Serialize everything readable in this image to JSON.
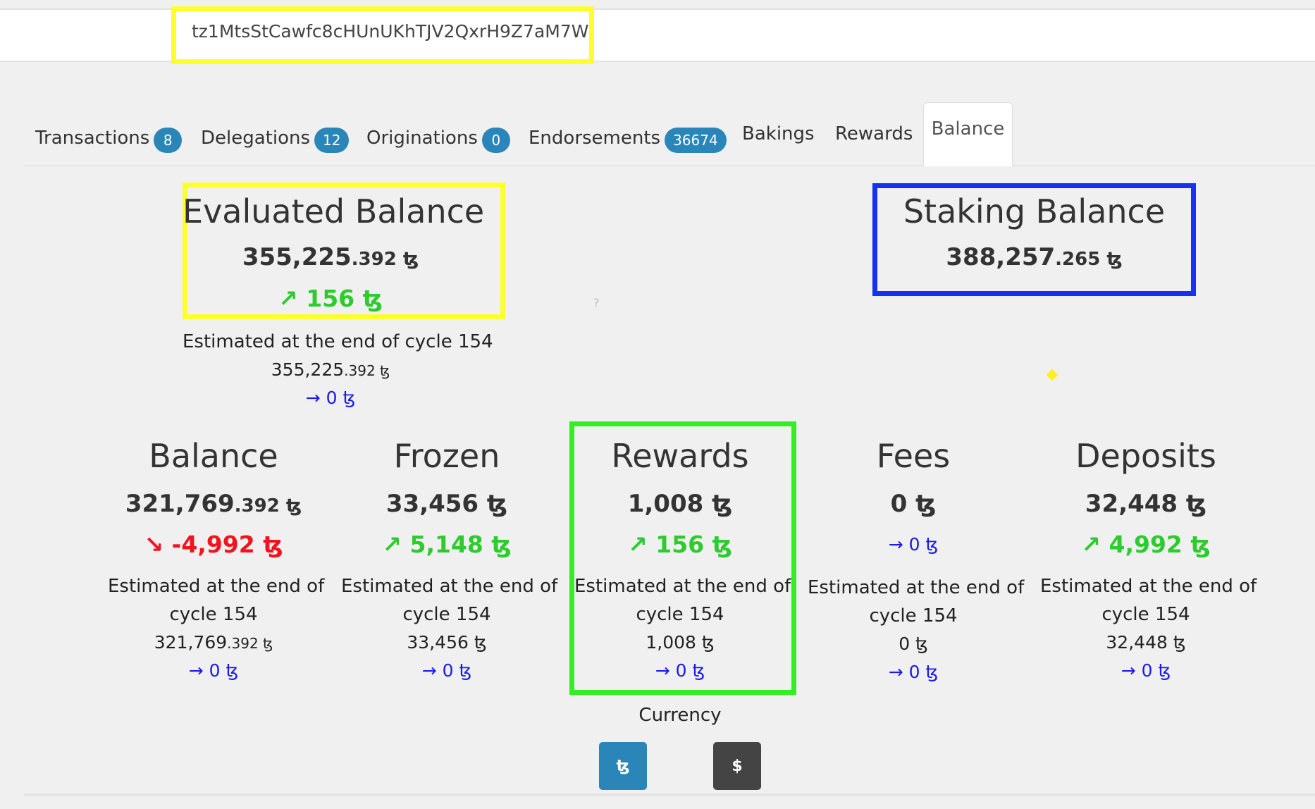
{
  "address": "tz1MtsStCawfc8cHUnUKhTJV2QxrH9Z7aM7W",
  "tabs": [
    {
      "label": "Transactions",
      "count": "8"
    },
    {
      "label": "Delegations",
      "count": "12"
    },
    {
      "label": "Originations",
      "count": "0"
    },
    {
      "label": "Endorsements",
      "count": "36674"
    },
    {
      "label": "Bakings"
    },
    {
      "label": "Rewards"
    },
    {
      "label": "Balance",
      "active": true
    }
  ],
  "evaluated": {
    "title": "Evaluated Balance",
    "amount_int": "355,225",
    "amount_dec": ".392 ꜩ",
    "change": "↗ 156 ꜩ",
    "est_label": "Estimated at the end of cycle 154",
    "est_int": "355,225",
    "est_dec": ".392 ꜩ",
    "est_change": "→ 0 ꜩ"
  },
  "staking": {
    "title": "Staking Balance",
    "amount_int": "388,257",
    "amount_dec": ".265 ꜩ"
  },
  "hint_mark": "?",
  "columns": [
    {
      "title": "Balance",
      "amount_int": "321,769",
      "amount_dec": ".392 ꜩ",
      "change": "↘ -4,992 ꜩ",
      "trend": "down",
      "est_line1": "Estimated at the end of",
      "est_line2": "cycle 154",
      "est_int": "321,769",
      "est_dec": ".392 ꜩ",
      "est_change": "→ 0 ꜩ"
    },
    {
      "title": "Frozen",
      "amount_int": "33,456 ꜩ",
      "amount_dec": "",
      "change": "↗ 5,148 ꜩ",
      "trend": "up",
      "est_line1": "Estimated at the end of",
      "est_line2": "cycle 154",
      "est_int": "33,456 ꜩ",
      "est_dec": "",
      "est_change": "→ 0 ꜩ"
    },
    {
      "title": "Rewards",
      "amount_int": "1,008 ꜩ",
      "amount_dec": "",
      "change": "↗ 156 ꜩ",
      "trend": "up",
      "est_line1": "Estimated at the end of",
      "est_line2": "cycle 154",
      "est_int": "1,008 ꜩ",
      "est_dec": "",
      "est_change": "→ 0 ꜩ"
    },
    {
      "title": "Fees",
      "amount_int": "0 ꜩ",
      "amount_dec": "",
      "change": "→ 0 ꜩ",
      "trend": "flat",
      "est_line1": "Estimated at the end of",
      "est_line2": "cycle 154",
      "est_int": "0 ꜩ",
      "est_dec": "",
      "est_change": "→ 0 ꜩ"
    },
    {
      "title": "Deposits",
      "amount_int": "32,448 ꜩ",
      "amount_dec": "",
      "change": "↗ 4,992 ꜩ",
      "trend": "up",
      "est_line1": "Estimated at the end of",
      "est_line2": "cycle 154",
      "est_int": "32,448 ꜩ",
      "est_dec": "",
      "est_change": "→ 0 ꜩ"
    }
  ],
  "currency": {
    "label": "Currency",
    "options": [
      {
        "symbol": "ꜩ",
        "selected": true,
        "color": "#2a86b8"
      },
      {
        "symbol": "$",
        "selected": false,
        "color": "#444444"
      }
    ]
  },
  "colors": {
    "highlight_yellow": "#ffff2e",
    "highlight_blue": "#1432f0",
    "highlight_green": "#33ee22",
    "positive": "#2ecb2e",
    "negative": "#f0141e",
    "neutral_link": "#1a1af0",
    "badge": "#2a86b8"
  }
}
